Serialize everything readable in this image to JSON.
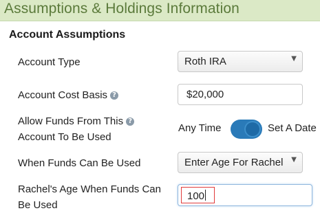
{
  "header": {
    "title": "Assumptions & Holdings Information"
  },
  "section": {
    "title": "Account Assumptions"
  },
  "fields": {
    "account_type": {
      "label": "Account Type",
      "value": "Roth IRA"
    },
    "cost_basis": {
      "label": "Account Cost Basis",
      "value": "$20,000",
      "help": "?"
    },
    "allow_funds": {
      "label_line1": "Allow Funds From This",
      "label_line2": "Account To Be Used",
      "help": "?",
      "option_left": "Any Time",
      "option_right": "Set A Date",
      "selected": "Set A Date"
    },
    "when_funds": {
      "label": "When Funds Can Be Used",
      "value": "Enter Age For Rachel"
    },
    "age": {
      "label_line1": "Rachel's Age When Funds Can",
      "label_line2": "Be Used",
      "value": "100"
    }
  },
  "icons": {
    "help": "question-circle-icon",
    "dropdown": "triangle-down-icon"
  },
  "colors": {
    "header_bg": "#dbe9c6",
    "header_text": "#5b7a3b",
    "toggle_on": "#2a7ab8",
    "highlight": "#e03a3a"
  }
}
